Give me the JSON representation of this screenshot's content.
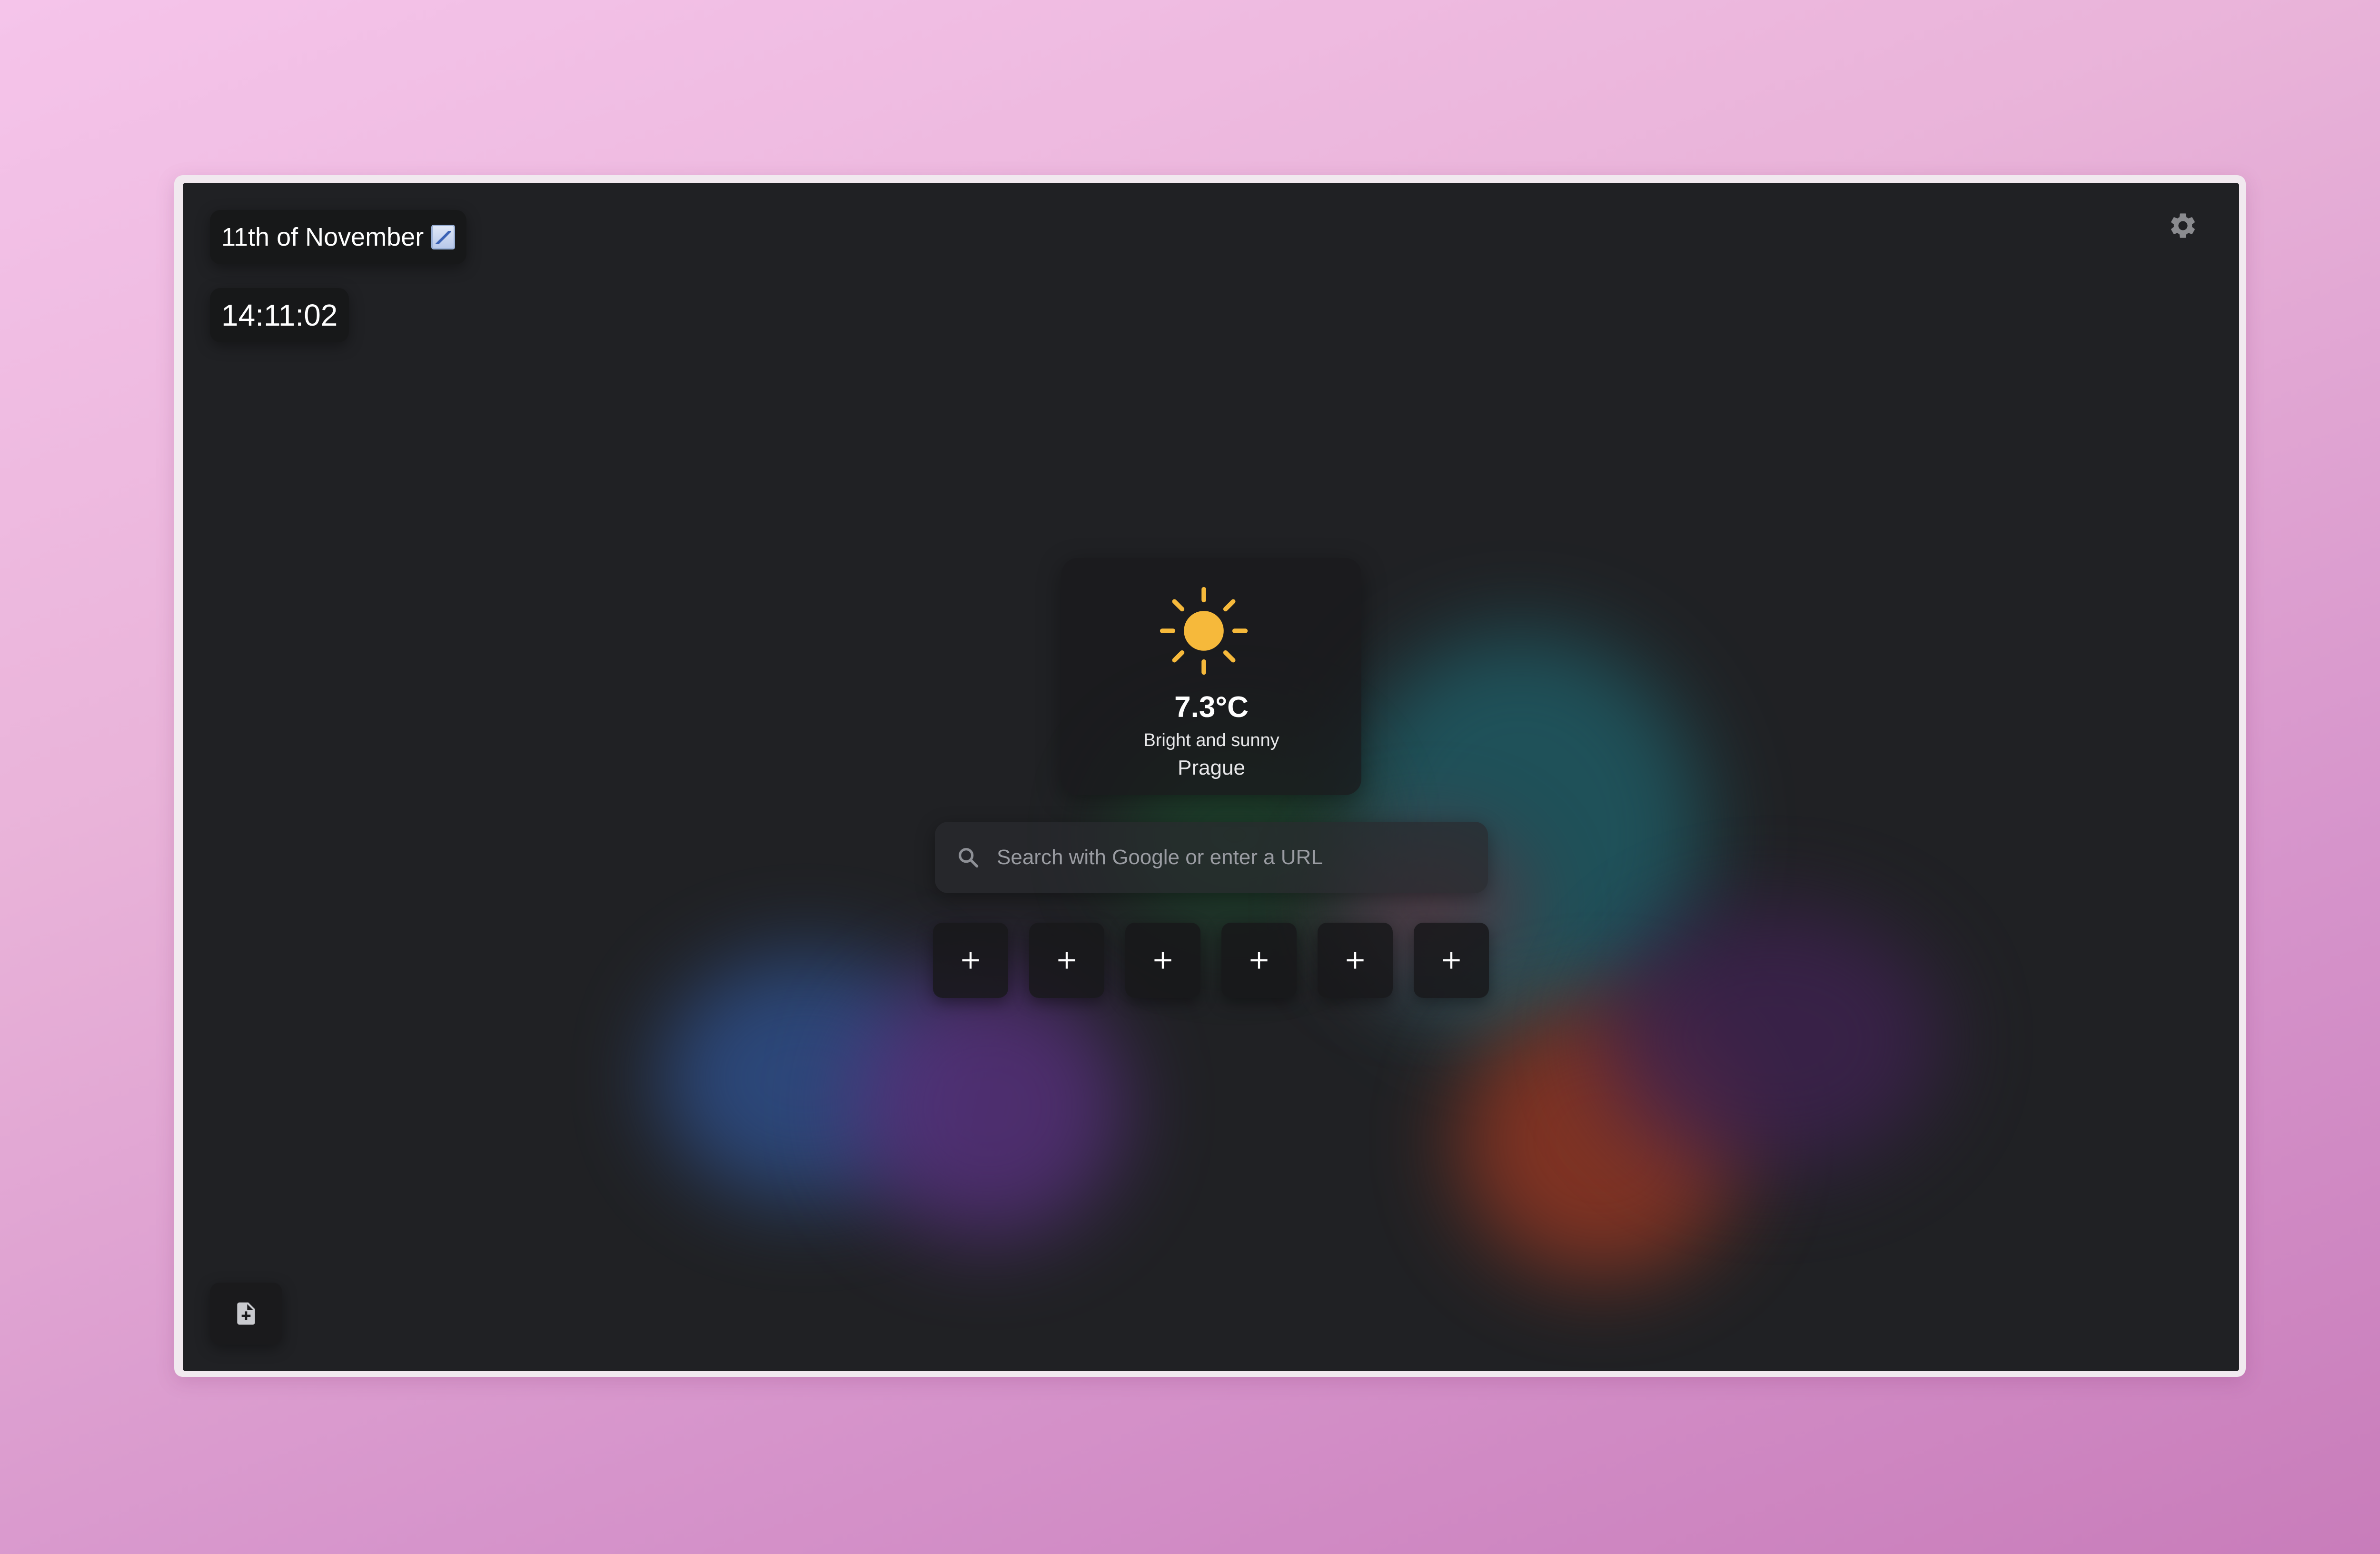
{
  "header": {
    "date": "11th of November",
    "date_icon": "calendar-chart-icon",
    "time": "14:11:02"
  },
  "settings": {
    "icon": "gear-icon"
  },
  "weather": {
    "icon": "sun-icon",
    "temperature": "7.3°C",
    "description": "Bright and sunny",
    "city": "Prague"
  },
  "search": {
    "icon": "search-icon",
    "placeholder": "Search with Google or enter a URL",
    "value": ""
  },
  "shortcuts": [
    {
      "icon": "plus-icon"
    },
    {
      "icon": "plus-icon"
    },
    {
      "icon": "plus-icon"
    },
    {
      "icon": "plus-icon"
    },
    {
      "icon": "plus-icon"
    },
    {
      "icon": "plus-icon"
    }
  ],
  "footer": {
    "new_note_icon": "new-document-icon"
  },
  "colors": {
    "page_background": "#e7b0d9",
    "screen_background": "#202124",
    "sun": "#f6b93b",
    "text": "#ffffff"
  }
}
